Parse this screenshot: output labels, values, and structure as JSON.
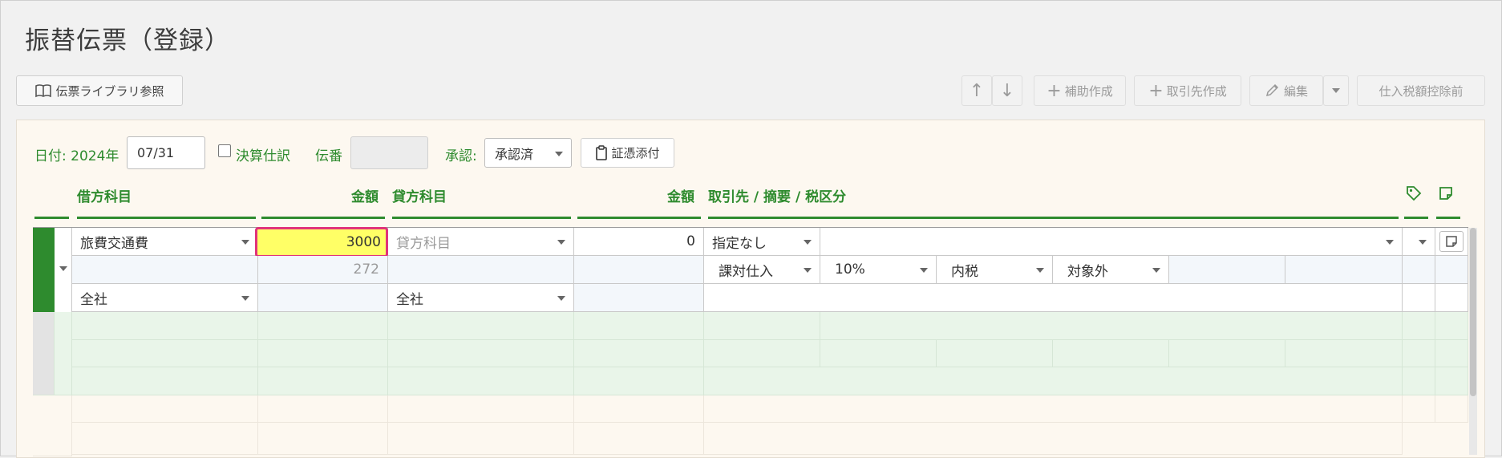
{
  "page": {
    "title": "振替伝票（登録）"
  },
  "toolbar": {
    "library_label": "伝票ライブラリ参照",
    "up_arrow": "↑",
    "down_arrow": "↓",
    "add_sub_label": "補助作成",
    "add_partner_label": "取引先作成",
    "edit_label": "編集",
    "tax_deduct_label": "仕入税額控除前"
  },
  "form": {
    "date_label": "日付: 2024年",
    "date_value": "07/31",
    "settlement_label": "決算仕訳",
    "slip_no_label": "伝番",
    "slip_no_value": "",
    "approval_label": "承認:",
    "approval_value": "承認済",
    "attach_label": "証憑添付"
  },
  "columns": {
    "debit_account": "借方科目",
    "debit_amount": "金額",
    "credit_account": "貸方科目",
    "credit_amount": "金額",
    "partner_memo_tax": "取引先 / 摘要 / 税区分"
  },
  "row1": {
    "debit_account": "旅費交通費",
    "debit_amount": "3000",
    "debit_tax_amount": "272",
    "debit_dept": "全社",
    "credit_account_placeholder": "貸方科目",
    "credit_amount": "0",
    "credit_dept": "全社",
    "partner": "指定なし",
    "memo": "",
    "tax_type": "課対仕入",
    "tax_rate": "10%",
    "tax_incl": "内税",
    "tax_scope": "対象外"
  },
  "colors": {
    "accent_green": "#2e8b2e",
    "highlight_yellow": "#ffff66",
    "focus_border": "#e0337a"
  }
}
